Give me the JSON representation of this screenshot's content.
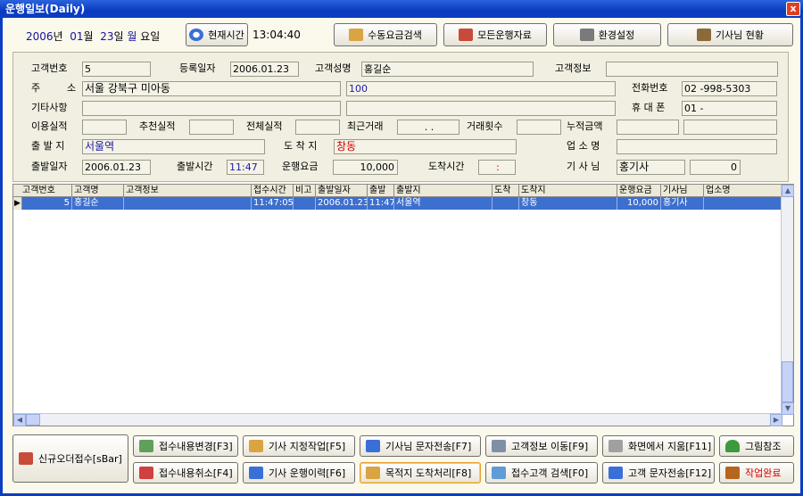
{
  "window": {
    "title": "운행일보(Daily)",
    "close": "x"
  },
  "date": {
    "year": "2006",
    "year_unit": "년",
    "month": "01",
    "month_unit": "월",
    "day": "23",
    "day_unit": "일",
    "weekday": "월",
    "weekday_unit": "요일"
  },
  "toolbar": {
    "now_button": "현재시간",
    "clock": "13:04:40",
    "manual_fare_search": "수동요금검색",
    "all_trip_data": "모든운행자료",
    "settings": "환경설정",
    "driver_status": "기사님 현황"
  },
  "form": {
    "labels": {
      "customer_no": "고객번호",
      "reg_date": "등록일자",
      "customer_name": "고객성명",
      "customer_info": "고객정보",
      "addr_1": "주",
      "addr_2": "소",
      "phone": "전화번호",
      "etc": "기타사항",
      "mobile": "휴 대 폰",
      "usage": "이용실적",
      "referral": "추천실적",
      "total": "전체실적",
      "recent": "최근거래",
      "count": "거래횟수",
      "accum": "누적금액",
      "origin": "출 발 지",
      "dest": "도 착 지",
      "business": "업 소 명",
      "depart_date": "출발일자",
      "depart_time": "출발시간",
      "fare": "운행요금",
      "arrive_time": "도착시간",
      "driver": "기 사 님"
    },
    "values": {
      "customer_no": "5",
      "reg_date": "2006.01.23",
      "customer_name": "홍길순",
      "customer_info": "",
      "address": "서울 강북구 미아동",
      "address_detail": "100",
      "phone": "02  -998-5303",
      "etc": "",
      "etc2": "",
      "mobile": "01  -",
      "recent": ".  .",
      "origin": "서울역",
      "dest": "창동",
      "business": "",
      "depart_date": "2006.01.23",
      "depart_time": "11:47",
      "fare": "10,000",
      "arrive_time": ":",
      "driver": "홍기사",
      "driver_no": "0"
    }
  },
  "grid": {
    "columns": [
      "고객번호",
      "고객명",
      "고객정보",
      "접수시간",
      "비고",
      "출발일자",
      "출발",
      "출발지",
      "도착",
      "도착지",
      "운행요금",
      "기사님",
      "업소명"
    ],
    "rows": [
      [
        "5",
        "홍길순",
        "",
        "11:47:05",
        "",
        "2006.01.23",
        "11:47",
        "서울역",
        "",
        "창동",
        "10,000",
        "홍기사",
        ""
      ]
    ]
  },
  "bottom": {
    "new_order": "신규오더접수[sBar]",
    "change_receipt": "접수내용변경[F3]",
    "assign_driver": "기사 지정작업[F5]",
    "driver_sms": "기사님 문자전송[F7]",
    "move_customer": "고객정보 이동[F9]",
    "remove_screen": "화면에서 지움[F11]",
    "picture_ref": "그림참조",
    "cancel_receipt": "접수내용취소[F4]",
    "driver_history": "기사 운행이력[F6]",
    "arrive_process": "목적지 도착처리[F8]",
    "search_customer": "접수고객 검색[F0]",
    "customer_sms": "고객 문자전송[F12]",
    "work_done": "작업완료"
  }
}
